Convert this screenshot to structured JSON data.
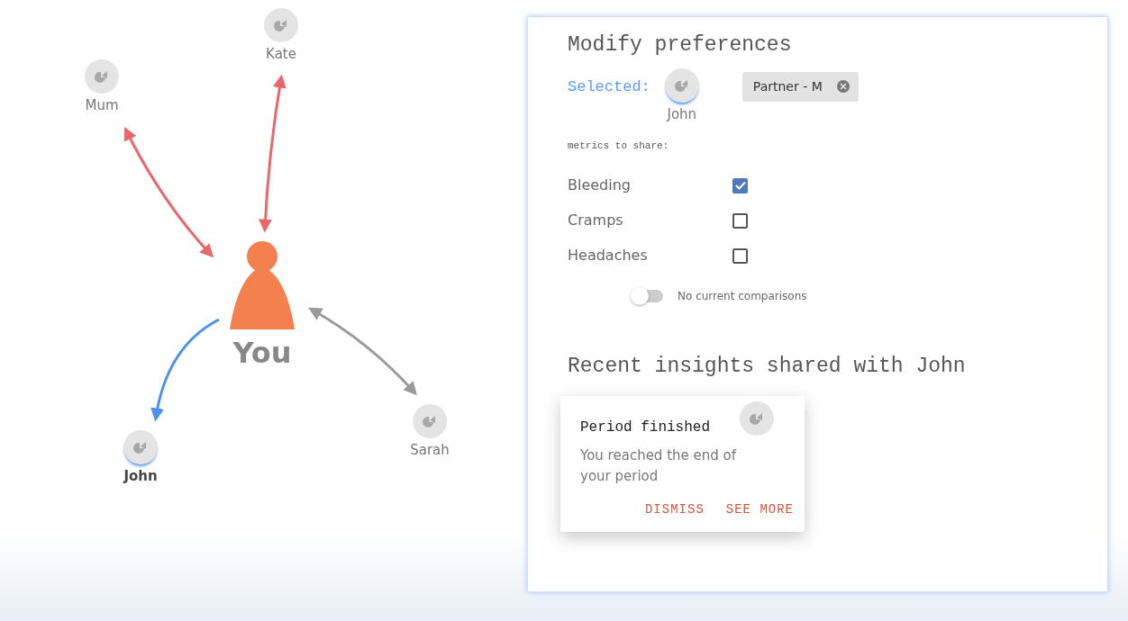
{
  "you": {
    "label": "You"
  },
  "contacts": [
    {
      "name": "Mum",
      "selected": false,
      "color": "#e8676b",
      "two_way": true
    },
    {
      "name": "Kate",
      "selected": false,
      "color": "#e8676b",
      "two_way": true
    },
    {
      "name": "John",
      "selected": true,
      "color": "#4f8ff0",
      "two_way": false
    },
    {
      "name": "Sarah",
      "selected": false,
      "color": "#9a9a9a",
      "two_way": true
    }
  ],
  "preferences": {
    "title": "Modify preferences",
    "selected_label": "Selected:",
    "selected_name": "John",
    "tag": "Partner - M",
    "metrics_label": "metrics to share:",
    "metrics": [
      {
        "label": "Bleeding",
        "checked": true
      },
      {
        "label": "Cramps",
        "checked": false
      },
      {
        "label": "Headaches",
        "checked": false
      }
    ],
    "comparison": {
      "on": false,
      "label": "No current comparisons"
    }
  },
  "insights": {
    "title": "Recent insights shared with John",
    "cards": [
      {
        "title": "Period finished",
        "text": "You reached the end of your period",
        "actions": [
          "DISMISS",
          "SEE MORE"
        ]
      }
    ]
  }
}
